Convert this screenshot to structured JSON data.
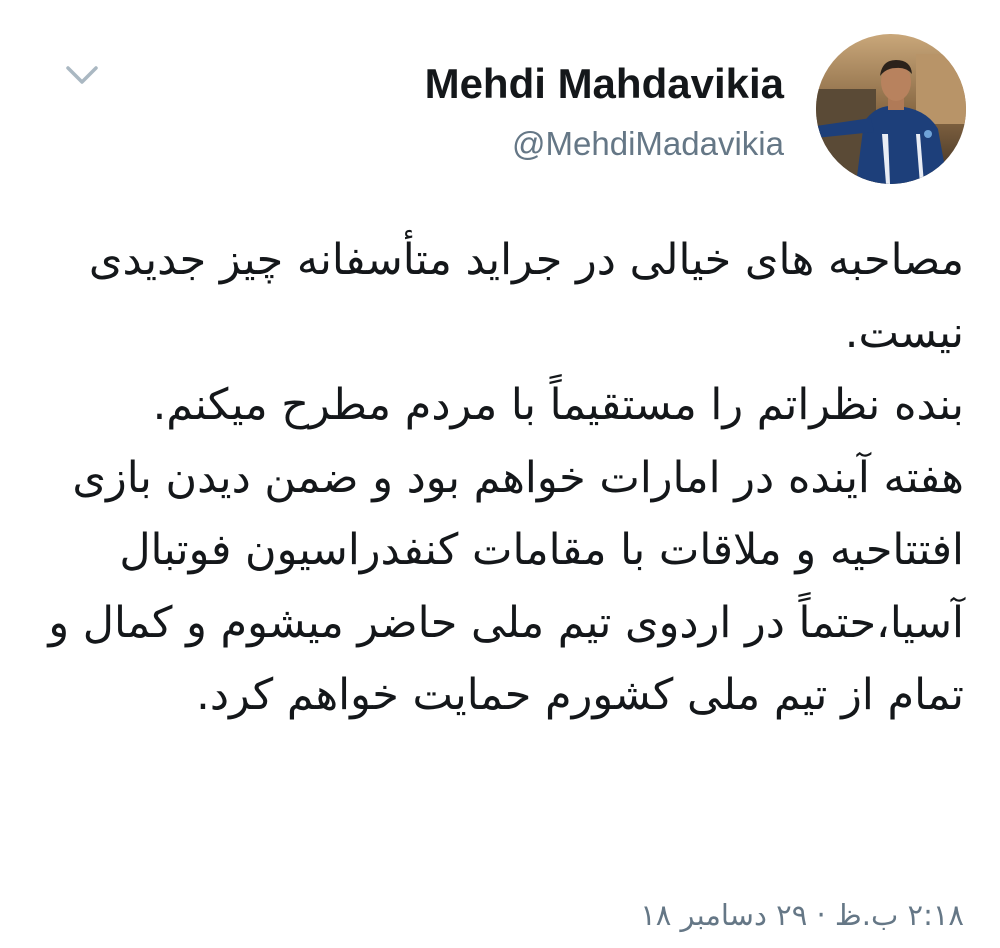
{
  "tweet": {
    "display_name": "Mehdi Mahdavikia",
    "handle": "@MehdiMadavikia",
    "avatar_icon": "profile-photo-avatar",
    "menu_icon": "chevron-down-icon",
    "paragraphs": [
      "مصاحبه های خیالی در جراید متأسفانه چیز جدیدی نیست.",
      "بنده نظراتم را مستقیماً با مردم مطرح میکنم.",
      "هفته آینده در امارات خواهم بود و ضمن دیدن بازی افتتاحیه و ملاقات با مقامات کنفدراسیون فوتبال آسیا،حتماً در اردوی تیم ملی حاضر میشوم و کمال و تمام از تیم ملی کشورم حمایت خواهم کرد."
    ],
    "timestamp": "۲:۱۸ ب.ظ · ۲۹ دسامبر ۱۸"
  },
  "colors": {
    "primary_text": "#14171a",
    "secondary_text": "#657786",
    "chevron": "#aab8c2",
    "background": "#ffffff"
  }
}
